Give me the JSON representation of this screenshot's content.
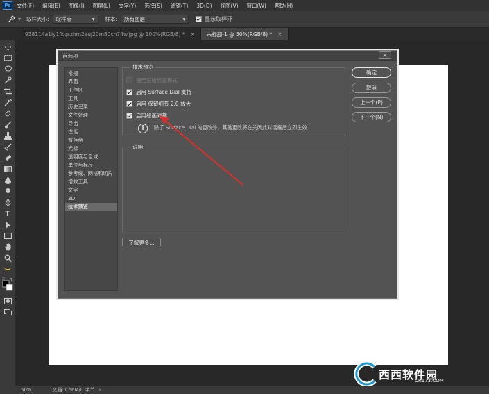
{
  "app": {
    "logo": "Ps",
    "menus": [
      "文件(F)",
      "编辑(E)",
      "图像(I)",
      "图层(L)",
      "文字(Y)",
      "选择(S)",
      "滤镜(T)",
      "3D(D)",
      "视图(V)",
      "窗口(W)",
      "帮助(H)"
    ]
  },
  "options": {
    "sample_size_label": "取样大小:",
    "sample_size_value": "取样点",
    "sample_label": "样本:",
    "sample_value": "所有图层",
    "show_ring_label": "显示取样环",
    "show_ring_checked": true
  },
  "tabs": [
    {
      "label": "938114a1ly1fkqszhm2auj20m80ch74w.jpg @ 100%(RGB/8) *",
      "active": false
    },
    {
      "label": "未标题-1 @ 50%(RGB/8) *",
      "active": true
    }
  ],
  "tools": [
    "move-icon",
    "marquee-icon",
    "lasso-icon",
    "quick-select-icon",
    "crop-icon",
    "eyedropper-icon",
    "healing-icon",
    "brush-icon",
    "stamp-icon",
    "history-brush-icon",
    "eraser-icon",
    "gradient-icon",
    "blur-icon",
    "dodge-icon",
    "pen-icon",
    "type-icon",
    "path-select-icon",
    "shape-icon",
    "hand-icon",
    "zoom-icon",
    "banana-icon",
    "colors-icon"
  ],
  "status": {
    "zoom": "50%",
    "doc_info": "文档:7.66M/0 字节"
  },
  "dialog": {
    "title": "首选项",
    "close": "×",
    "nav": [
      "常规",
      "界面",
      "工作区",
      "工具",
      "历史记录",
      "文件处理",
      "导出",
      "性能",
      "暂存盘",
      "光标",
      "透明度与色域",
      "单位与标尺",
      "参考线、网格和切片",
      "增效工具",
      "文字",
      "3D",
      "技术预览"
    ],
    "selected_nav_index": 16,
    "section_title": "技术预览",
    "options": [
      {
        "label": "使用旧版修复模式",
        "checked": false,
        "disabled": true
      },
      {
        "label": "启用 Surface Dial 支持",
        "checked": true,
        "disabled": false
      },
      {
        "label": "启用 保留细节 2.0 放大",
        "checked": true,
        "disabled": false
      },
      {
        "label": "启用绘画对称",
        "checked": true,
        "disabled": false
      }
    ],
    "info_text": "除了 Surface Dial 的更改外，其他更改将在关闭此对话框后立即生效",
    "description_title": "说明",
    "learn_more": "了解更多...",
    "buttons": {
      "ok": "确定",
      "cancel": "取消",
      "prev": "上一个(P)",
      "next": "下一个(N)"
    }
  },
  "colors": {
    "arrow": "#d9302c",
    "accent": "#31a8ff"
  },
  "watermark": {
    "main": "西西软件园",
    "sub": "CR173.COM"
  }
}
